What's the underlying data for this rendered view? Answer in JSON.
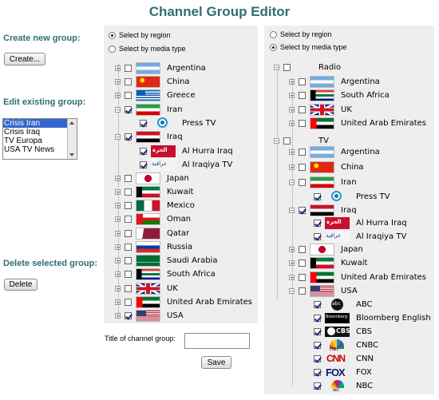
{
  "title": "Channel Group Editor",
  "sidebar": {
    "create_label": "Create new group:",
    "create_button": "Create...",
    "edit_label": "Edit existing group:",
    "groups": [
      "Crisis Iran",
      "Crisis Iraq",
      "TV Europa",
      "USA TV News"
    ],
    "selected_group": "Crisis Iran",
    "delete_label": "Delete selected group:",
    "delete_button": "Delete"
  },
  "left_panel": {
    "radio_region": "Select by region",
    "radio_media": "Select by media type",
    "selected_mode": "region",
    "rows": [
      {
        "kind": "country",
        "name": "Argentina",
        "flag": "argentina",
        "checked": false
      },
      {
        "kind": "country",
        "name": "China",
        "flag": "china",
        "checked": false
      },
      {
        "kind": "country",
        "name": "Greece",
        "flag": "greece",
        "checked": false
      },
      {
        "kind": "country",
        "name": "Iran",
        "flag": "iran",
        "checked": true,
        "expanded": true
      },
      {
        "kind": "channel",
        "name": "Press TV",
        "logo": "presstv-icon",
        "checked": true
      },
      {
        "kind": "country",
        "name": "Iraq",
        "flag": "iraq",
        "checked": true,
        "expanded": true
      },
      {
        "kind": "channel",
        "name": "Al Hurra Iraq",
        "logo": "alhurra-icon",
        "checked": true
      },
      {
        "kind": "channel",
        "name": "Al Iraqiya TV",
        "logo": "aliraqiya-icon",
        "checked": true
      },
      {
        "kind": "country",
        "name": "Japan",
        "flag": "japan",
        "checked": false
      },
      {
        "kind": "country",
        "name": "Kuwait",
        "flag": "kuwait",
        "checked": false
      },
      {
        "kind": "country",
        "name": "Mexico",
        "flag": "mexico",
        "checked": false
      },
      {
        "kind": "country",
        "name": "Oman",
        "flag": "oman",
        "checked": false
      },
      {
        "kind": "country",
        "name": "Qatar",
        "flag": "qatar",
        "checked": false
      },
      {
        "kind": "country",
        "name": "Russia",
        "flag": "russia",
        "checked": false
      },
      {
        "kind": "country",
        "name": "Saudi Arabia",
        "flag": "saudi",
        "checked": false
      },
      {
        "kind": "country",
        "name": "South Africa",
        "flag": "southafrica",
        "checked": false
      },
      {
        "kind": "country",
        "name": "UK",
        "flag": "uk",
        "checked": false
      },
      {
        "kind": "country",
        "name": "United Arab Emirates",
        "flag": "uae",
        "checked": false
      },
      {
        "kind": "country",
        "name": "USA",
        "flag": "usa",
        "checked": true
      }
    ],
    "title_field_label": "Title of channel group:",
    "title_field_value": "",
    "save_button": "Save"
  },
  "right_panel": {
    "radio_region": "Select by region",
    "radio_media": "Select by media type",
    "selected_mode": "media",
    "rows": [
      {
        "kind": "media",
        "name": "Radio",
        "checked": false
      },
      {
        "kind": "country",
        "name": "Argentina",
        "flag": "argentina",
        "checked": false
      },
      {
        "kind": "country",
        "name": "South Africa",
        "flag": "southafrica",
        "checked": false
      },
      {
        "kind": "country",
        "name": "UK",
        "flag": "uk",
        "checked": false
      },
      {
        "kind": "country",
        "name": "United Arab Emirates",
        "flag": "uae",
        "checked": false
      },
      {
        "kind": "media",
        "name": "TV",
        "checked": false
      },
      {
        "kind": "country",
        "name": "Argentina",
        "flag": "argentina",
        "checked": false
      },
      {
        "kind": "country",
        "name": "China",
        "flag": "china",
        "checked": false
      },
      {
        "kind": "country",
        "name": "Iran",
        "flag": "iran",
        "checked": false
      },
      {
        "kind": "channel",
        "name": "Press TV",
        "logo": "presstv-icon",
        "checked": true
      },
      {
        "kind": "country",
        "name": "Iraq",
        "flag": "iraq",
        "checked": true
      },
      {
        "kind": "channel",
        "name": "Al Hurra Iraq",
        "logo": "alhurra-icon",
        "checked": true
      },
      {
        "kind": "channel",
        "name": "Al Iraqiya TV",
        "logo": "aliraqiya-icon",
        "checked": true
      },
      {
        "kind": "country",
        "name": "Japan",
        "flag": "japan",
        "checked": false
      },
      {
        "kind": "country",
        "name": "Kuwait",
        "flag": "kuwait",
        "checked": false
      },
      {
        "kind": "country",
        "name": "United Arab Emirates",
        "flag": "uae",
        "checked": false
      },
      {
        "kind": "country",
        "name": "USA",
        "flag": "usa",
        "checked": false
      },
      {
        "kind": "channel",
        "name": "ABC",
        "logo": "abc-icon",
        "checked": true
      },
      {
        "kind": "channel",
        "name": "Bloomberg English",
        "logo": "bloomberg-icon",
        "checked": true
      },
      {
        "kind": "channel",
        "name": "CBS",
        "logo": "cbs-icon",
        "checked": true
      },
      {
        "kind": "channel",
        "name": "CNBC",
        "logo": "cnbc-icon",
        "checked": true
      },
      {
        "kind": "channel",
        "name": "CNN",
        "logo": "cnn-icon",
        "checked": true
      },
      {
        "kind": "channel",
        "name": "FOX",
        "logo": "fox-icon",
        "checked": true
      },
      {
        "kind": "channel",
        "name": "NBC",
        "logo": "nbc-icon",
        "checked": true
      }
    ]
  },
  "colors": {
    "heading": "#2f6f6f",
    "panel_bg": "#eeeeee",
    "selection": "#3366cc"
  }
}
